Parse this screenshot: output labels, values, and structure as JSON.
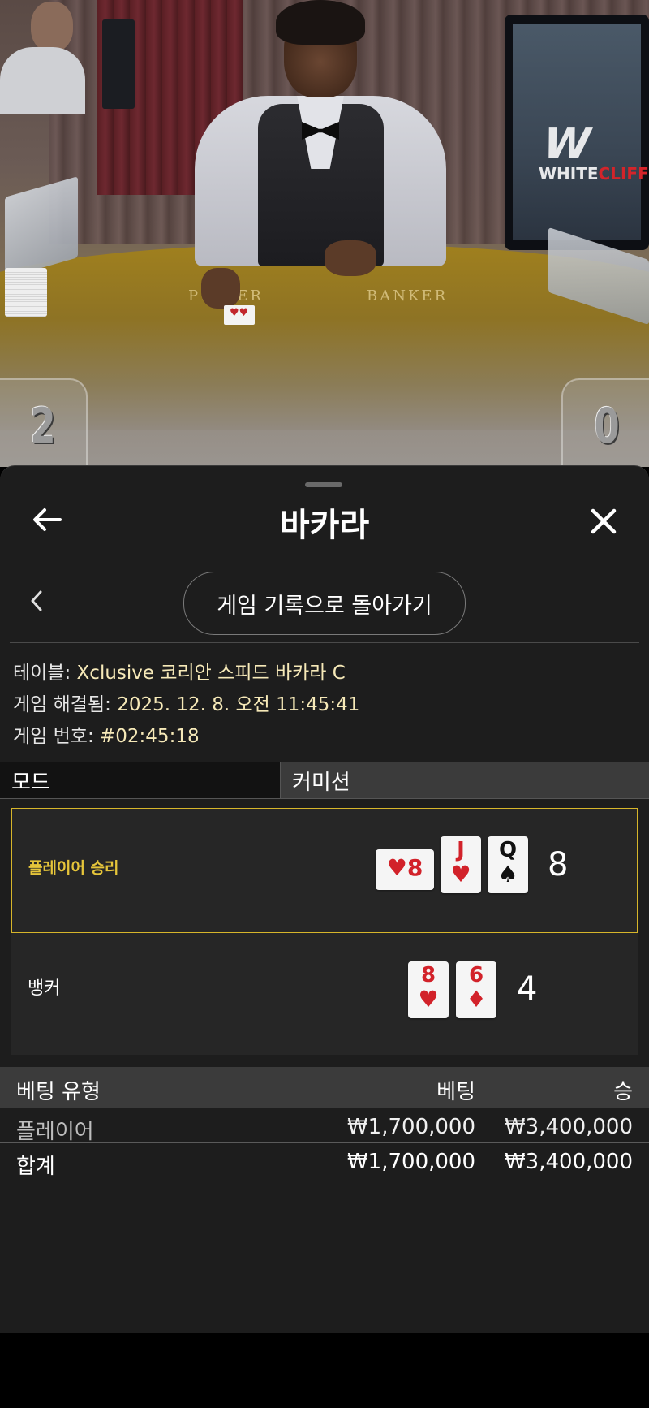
{
  "video": {
    "felt_labels": {
      "player": "PLAYER",
      "banker": "BANKER"
    },
    "brand_logo": {
      "mark": "W",
      "word_a": "WHITE",
      "word_b": "CLIFF",
      "accent_color": "#d4242a"
    },
    "score_player": "2",
    "score_banker": "0"
  },
  "header": {
    "title": "바카라",
    "back_icon": "arrow-left-icon",
    "close_icon": "close-icon"
  },
  "nav": {
    "back_icon": "chevron-left-icon",
    "history_button_label": "게임 기록으로 돌아가기"
  },
  "game_info": {
    "table_label": "테이블:",
    "table_value": "Xclusive 코리안 스피드 바카라 C",
    "resolved_label": "게임 해결됨:",
    "resolved_value": "2025. 12. 8. 오전 11:45:41",
    "number_label": "게임 번호:",
    "number_value": "#02:45:18"
  },
  "mode": {
    "label": "모드",
    "value": "커미션"
  },
  "results": {
    "player": {
      "label": "플레이어 승리",
      "score": "8",
      "highlight_color": "#d6b52a",
      "cards": [
        {
          "rank": "8",
          "suit": "♥",
          "orientation": "sideways"
        },
        {
          "rank": "J",
          "suit": "♥"
        },
        {
          "rank": "Q",
          "suit": "♠"
        }
      ]
    },
    "banker": {
      "label": "뱅커",
      "score": "4",
      "cards": [
        {
          "rank": "8",
          "suit": "♥"
        },
        {
          "rank": "6",
          "suit": "♦"
        }
      ]
    }
  },
  "bets": {
    "headers": {
      "type": "베팅 유형",
      "bet": "베팅",
      "win": "승"
    },
    "rows": [
      {
        "type": "플레이어",
        "bet": "₩1,700,000",
        "win": "₩3,400,000"
      }
    ],
    "total": {
      "type": "합계",
      "bet": "₩1,700,000",
      "win": "₩3,400,000"
    }
  }
}
